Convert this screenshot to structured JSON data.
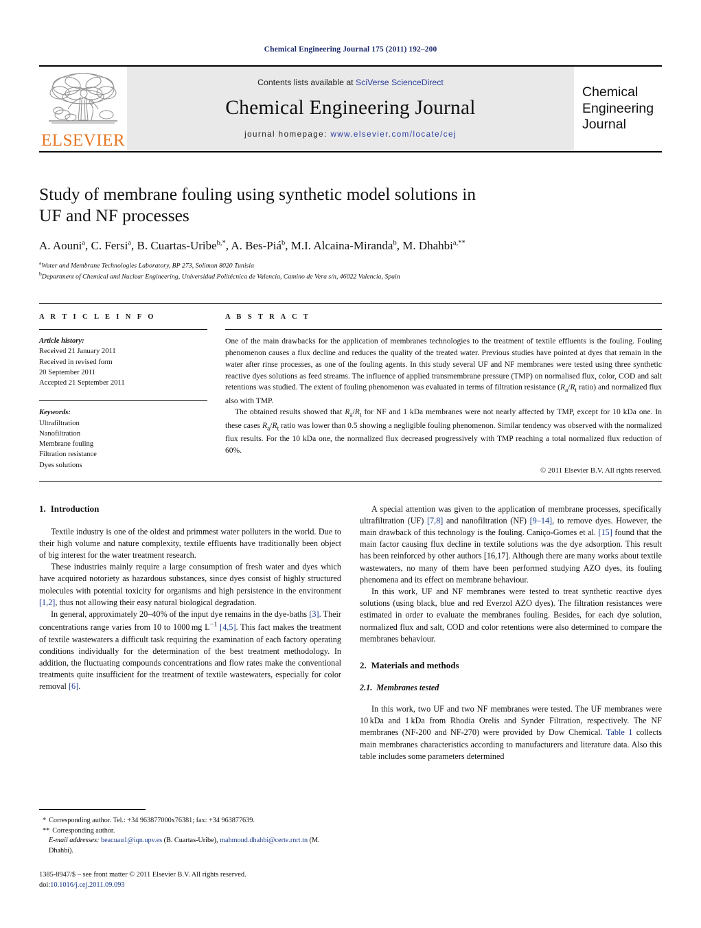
{
  "running_head": "Chemical Engineering Journal 175 (2011) 192–200",
  "masthead": {
    "publisher_logo_text": "ELSEVIER",
    "contents_prefix": "Contents lists available at",
    "contents_link": "SciVerse ScienceDirect",
    "journal_title": "Chemical Engineering Journal",
    "homepage_prefix": "journal homepage:",
    "homepage_url": "www.elsevier.com/locate/cej",
    "cover_line_1": "Chemical",
    "cover_line_2": "Engineering",
    "cover_line_3": "Journal",
    "accent_orange": "#e87722",
    "link_blue": "#2b3f9c",
    "banner_bg": "#e9e9ea"
  },
  "title": {
    "line1": "Study of membrane fouling using synthetic model solutions in",
    "line2": "UF and NF processes"
  },
  "authors": [
    {
      "name": "A. Aouni",
      "sup": "a"
    },
    {
      "name": "C. Fersi",
      "sup": "a"
    },
    {
      "name": "B. Cuartas-Uribe",
      "sup": "b,*"
    },
    {
      "name": "A. Bes-Piá",
      "sup": "b"
    },
    {
      "name": "M.I. Alcaina-Miranda",
      "sup": "b"
    },
    {
      "name": "M. Dhahbi",
      "sup": "a,**"
    }
  ],
  "affiliations": [
    {
      "mark": "a",
      "text": "Water and Membrane Technologies Laboratory, BP 273, Soliman 8020 Tunisia"
    },
    {
      "mark": "b",
      "text": "Department of Chemical and Nuclear Engineering, Universidad Politécnica de Valencia, Camino de Vera s/n, 46022 Valencia, Spain"
    }
  ],
  "article_info": {
    "heading": "A R T I C L E   I N F O",
    "history_label": "Article history:",
    "history_lines": [
      "Received 21 January 2011",
      "Received in revised form",
      "20 September 2011",
      "Accepted 21 September 2011"
    ],
    "keywords_label": "Keywords:",
    "keywords": [
      "Ultrafiltration",
      "Nanofiltration",
      "Membrane fouling",
      "Filtration resistance",
      "Dyes solutions"
    ]
  },
  "abstract": {
    "heading": "A B S T R A C T",
    "paragraph_1": "One of the main drawbacks for the application of membranes technologies to the treatment of textile effluents is the fouling. Fouling phenomenon causes a flux decline and reduces the quality of the treated water. Previous studies have pointed at dyes that remain in the water after rinse processes, as one of the fouling agents. In this study several UF and NF membranes were tested using three synthetic reactive dyes solutions as feed streams. The influence of applied transmembrane pressure (TMP) on normalised flux, color, COD and salt retentions was studied. The extent of fouling phenomenon was evaluated in terms of filtration resistance (Ra/Rt ratio) and normalized flux also with TMP.",
    "paragraph_2": "The obtained results showed that Ra/Rt for NF and 1 kDa membranes were not nearly affected by TMP, except for 10 kDa one. In these cases Ra/Rt ratio was lower than 0.5 showing a negligible fouling phenomenon. Similar tendency was observed with the normalized flux results. For the 10 kDa one, the normalized flux decreased progressively with TMP reaching a total normalized flux reduction of 60%.",
    "copyright": "© 2011 Elsevier B.V. All rights reserved."
  },
  "body": {
    "section_1": {
      "number": "1.",
      "title": "Introduction",
      "p1": "Textile industry is one of the oldest and primmest water polluters in the world. Due to their high volume and nature complexity, textile effluents have traditionally been object of big interest for the water treatment research.",
      "p2": "These industries mainly require a large consumption of fresh water and dyes which have acquired notoriety as hazardous substances, since dyes consist of highly structured molecules with potential toxicity for organisms and high persistence in the environment [1,2], thus not allowing their easy natural biological degradation.",
      "p3": "In general, approximately 20–40% of the input dye remains in the dye-baths [3]. Their concentrations range varies from 10 to 1000 mg L−1 [4,5]. This fact makes the treatment of textile wastewaters a difficult task requiring the examination of each factory operating conditions individually for the determination of the best treatment methodology. In addition, the fluctuating compounds concentrations and flow rates make the conventional treatments quite insufficient for the treatment of textile wastewaters, especially for color removal [6].",
      "p4": "A special attention was given to the application of membrane processes, specifically ultrafiltration (UF) [7,8] and nanofiltration (NF) [9–14], to remove dyes. However, the main drawback of this technology is the fouling. Caniço-Gomes et al. [15] found that the main factor causing flux decline in textile solutions was the dye adsorption. This result has been reinforced by other authors [16,17]. Although there are many works about textile wastewaters, no many of them have been performed studying AZO dyes, its fouling phenomena and its effect on membrane behaviour.",
      "p5": "In this work, UF and NF membranes were tested to treat synthetic reactive dyes solutions (using black, blue and red Everzol AZO dyes). The filtration resistances were estimated in order to evaluate the membranes fouling. Besides, for each dye solution, normalized flux and salt, COD and color retentions were also determined to compare the membranes behaviour."
    },
    "section_2": {
      "number": "2.",
      "title": "Materials and methods",
      "sub_number": "2.1.",
      "sub_title": "Membranes tested",
      "p1": "In this work, two UF and two NF membranes were tested. The UF membranes were 10 kDa and 1 kDa from Rhodia Orelis and Synder Filtration, respectively. The NF membranes (NF-200 and NF-270) were provided by Dow Chemical. Table 1 collects main membranes characteristics according to manufacturers and literature data. Also this table includes some parameters determined"
    },
    "citations": {
      "c12": "[1,2]",
      "c3": "[3]",
      "c45": "[4,5]",
      "c6": "[6]",
      "c78": "[7,8]",
      "c914": "[9–14]",
      "c15": "[15]",
      "c1617": "[16,17]",
      "table_link": "Table 1"
    }
  },
  "footnotes": {
    "line1_mark": "*",
    "line1": "Corresponding author. Tel.: +34 963877000x76381; fax: +34 963877639.",
    "line2_mark": "**",
    "line2": "Corresponding author.",
    "email_label": "E-mail addresses:",
    "email_1": "beacuau1@iqn.upv.es",
    "email_1_owner": "(B. Cuartas-Uribe),",
    "email_2": "mahmoud.dhahbi@certe.rnrt.tn",
    "email_2_owner": "(M. Dhahbi).",
    "imprint": "1385-8947/$ – see front matter © 2011 Elsevier B.V. All rights reserved.",
    "doi_label": "doi:",
    "doi": "10.1016/j.cej.2011.09.093"
  }
}
